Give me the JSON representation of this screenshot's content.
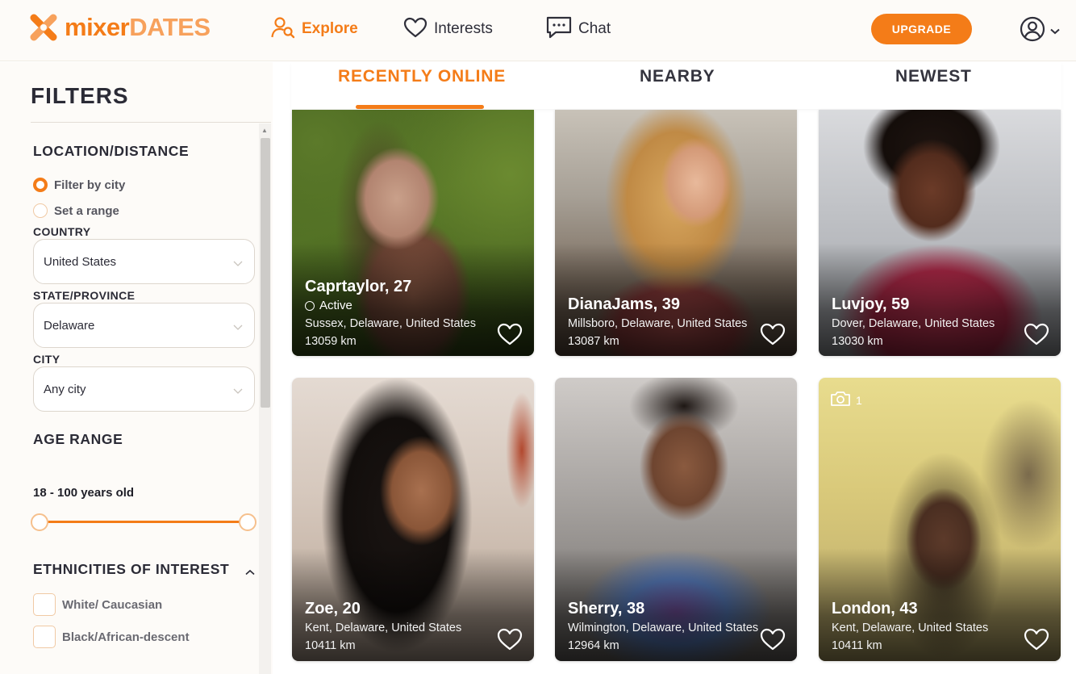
{
  "brand": {
    "name_a": "mixer",
    "name_b": "DATES"
  },
  "nav": {
    "explore": "Explore",
    "interests": "Interests",
    "chat": "Chat",
    "upgrade": "UPGRADE"
  },
  "colors": {
    "accent": "#f47c18",
    "accent_light": "#f7a15c"
  },
  "sidebar": {
    "title": "FILTERS",
    "location": {
      "title": "LOCATION/DISTANCE",
      "filter_by_city": "Filter by city",
      "set_range": "Set a range",
      "selected_mode": "Filter by city",
      "country_label": "COUNTRY",
      "country_value": "United States",
      "state_label": "STATE/PROVINCE",
      "state_value": "Delaware",
      "city_label": "CITY",
      "city_value": "Any city"
    },
    "age": {
      "title": "AGE RANGE",
      "value_text": "18 - 100 years old",
      "min": 18,
      "max": 100
    },
    "ethnicities": {
      "title": "ETHNICITIES OF INTEREST",
      "options": [
        "White/ Caucasian",
        "Black/African-descent"
      ]
    }
  },
  "tabs": {
    "recently_online": "RECENTLY ONLINE",
    "nearby": "NEARBY",
    "newest": "NEWEST",
    "active": "RECENTLY ONLINE"
  },
  "profiles": [
    {
      "name": "Caprtaylor, 27",
      "status": "Active",
      "location": "Sussex, Delaware, United States",
      "distance": "13059 km"
    },
    {
      "name": "DianaJams, 39",
      "location": "Millsboro, Delaware, United States",
      "distance": "13087 km"
    },
    {
      "name": "Luvjoy, 59",
      "location": "Dover, Delaware, United States",
      "distance": "13030 km"
    },
    {
      "name": "Zoe, 20",
      "location": "Kent, Delaware, United States",
      "distance": "10411 km"
    },
    {
      "name": "Sherry, 38",
      "location": "Wilmington, Delaware, United States",
      "distance": "12964 km"
    },
    {
      "name": "London, 43",
      "location": "Kent, Delaware, United States",
      "distance": "10411 km",
      "photo_count": "1"
    }
  ]
}
